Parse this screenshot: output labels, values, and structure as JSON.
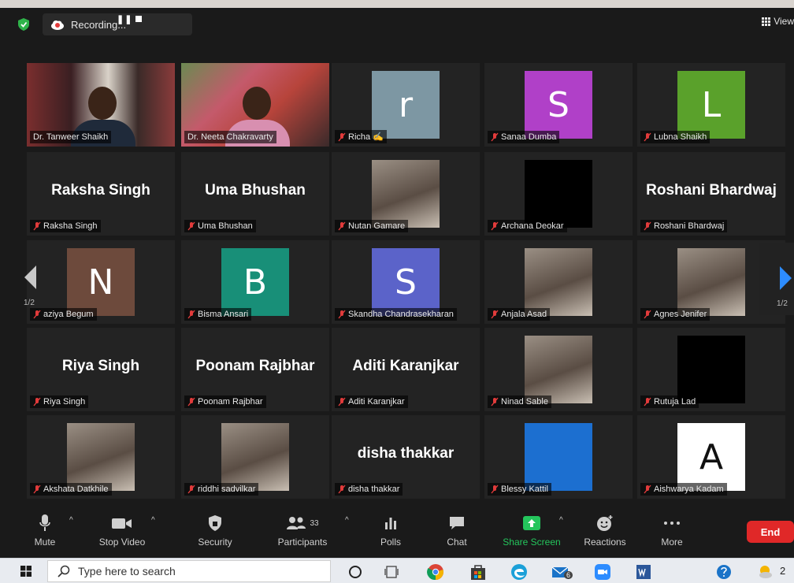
{
  "recording": {
    "label": "Recording...",
    "pause_glyph": "❚❚"
  },
  "view_button": {
    "label": "View"
  },
  "pagination": {
    "left": "1/2",
    "right": "1/2"
  },
  "tiles": [
    {
      "name": "Dr. Tanweer Shaikh",
      "kind": "video",
      "muted": false,
      "active": true
    },
    {
      "name": "Dr. Neeta Chakravarty",
      "kind": "video",
      "muted": false
    },
    {
      "name": "Richa ✍",
      "kind": "avatar",
      "letter": "r",
      "color": "#7d97a3",
      "muted": true
    },
    {
      "name": "Sanaa Dumba",
      "kind": "avatar",
      "letter": "S",
      "color": "#b040c8",
      "muted": true
    },
    {
      "name": "Lubna Shaikh",
      "kind": "avatar",
      "letter": "L",
      "color": "#5aa12b",
      "muted": true
    },
    {
      "name": "Raksha Singh",
      "kind": "text",
      "display": "Raksha Singh",
      "muted": true
    },
    {
      "name": "Uma Bhushan",
      "kind": "text",
      "display": "Uma Bhushan",
      "muted": true
    },
    {
      "name": "Nutan Gamare",
      "kind": "photo",
      "muted": true
    },
    {
      "name": "Archana Deokar",
      "kind": "black",
      "muted": true
    },
    {
      "name": "Roshani Bhardwaj",
      "kind": "text",
      "display": "Roshani Bhardwaj",
      "muted": true
    },
    {
      "name": "aziya Begum",
      "kind": "avatar",
      "letter": "N",
      "color": "#6d4a3c",
      "muted": true
    },
    {
      "name": "Bisma Ansari",
      "kind": "avatar",
      "letter": "B",
      "color": "#188f78",
      "muted": true
    },
    {
      "name": "Skandha Chandrasekharan",
      "kind": "avatar",
      "letter": "S",
      "color": "#5b63c9",
      "muted": true
    },
    {
      "name": "Anjala Asad",
      "kind": "photo",
      "muted": true
    },
    {
      "name": "Agnes Jenifer",
      "kind": "photo",
      "muted": true
    },
    {
      "name": "Riya Singh",
      "kind": "text",
      "display": "Riya Singh",
      "muted": true
    },
    {
      "name": "Poonam Rajbhar",
      "kind": "text",
      "display": "Poonam Rajbhar",
      "muted": true
    },
    {
      "name": "Aditi Karanjkar",
      "kind": "text",
      "display": "Aditi Karanjkar",
      "muted": true
    },
    {
      "name": "Ninad Sable",
      "kind": "photo",
      "muted": true
    },
    {
      "name": "Rutuja Lad",
      "kind": "black",
      "muted": true
    },
    {
      "name": "Akshata Datkhile",
      "kind": "photo",
      "muted": true
    },
    {
      "name": "riddhi sadvilkar",
      "kind": "photo",
      "muted": true
    },
    {
      "name": "disha thakkar",
      "kind": "text",
      "display": "disha thakkar",
      "muted": true
    },
    {
      "name": "Blessy Kattil",
      "kind": "blue",
      "muted": true
    },
    {
      "name": "Aishwarya Kadam",
      "kind": "avatar",
      "letter": "A",
      "color": "#ffffff",
      "letter_color": "#111",
      "muted": true
    }
  ],
  "toolbar": {
    "mute": "Mute",
    "stop_video": "Stop Video",
    "security": "Security",
    "participants": "Participants",
    "participants_count": "33",
    "polls": "Polls",
    "chat": "Chat",
    "share_screen": "Share Screen",
    "reactions": "Reactions",
    "more": "More",
    "end": "End"
  },
  "taskbar": {
    "search_placeholder": "Type here to search",
    "mail_badge": "6",
    "tray_partial": "2"
  },
  "colors": {
    "active_outline": "#c6e83a",
    "share_green": "#24c55c",
    "end_red": "#e02828",
    "mic_red": "#e23b3b"
  }
}
